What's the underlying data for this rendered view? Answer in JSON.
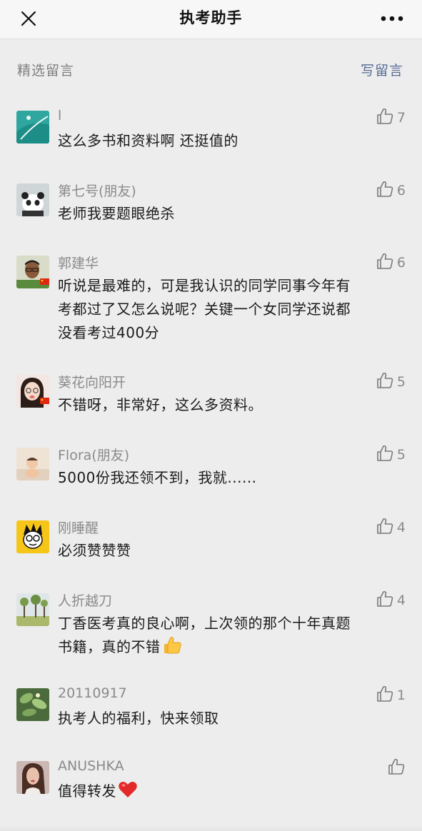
{
  "header": {
    "title": "执考助手",
    "close_icon": "close-icon",
    "more_icon": "more-icon"
  },
  "section": {
    "title": "精选留言",
    "write_label": "写留言"
  },
  "colors": {
    "link": "#576b95",
    "muted": "#8a8a8a",
    "background": "#ededed"
  },
  "comments": [
    {
      "name": "l",
      "likes": "7",
      "lines": [
        "这么多书和资料啊 还挺值的"
      ],
      "avatar_icon": "avatar-teal"
    },
    {
      "name": "第七号(朋友)",
      "likes": "6",
      "lines": [
        "老师我要题眼绝杀"
      ],
      "avatar_icon": "avatar-panda"
    },
    {
      "name": "郭建华",
      "likes": "6",
      "lines": [
        "听说是最难的，可是我认识的同学同事今年有",
        "考都过了又怎么说呢？关键一个女同学还说都",
        "没看考过400分"
      ],
      "avatar_icon": "avatar-man-flag"
    },
    {
      "name": "葵花向阳开",
      "likes": "5",
      "lines": [
        "不错呀，非常好，这么多资料。"
      ],
      "avatar_icon": "avatar-girl-flag"
    },
    {
      "name": "Flora(朋友)",
      "likes": "5",
      "lines": [
        "5000份我还领不到，我就......"
      ],
      "avatar_icon": "avatar-baby"
    },
    {
      "name": "刚睡醒",
      "likes": "4",
      "lines": [
        "必须赞赞赞"
      ],
      "avatar_icon": "avatar-cartoon"
    },
    {
      "name": "人折越刀",
      "likes": "4",
      "lines": [
        "丁香医考真的良心啊，上次领的那个十年真题",
        "书籍，真的不错"
      ],
      "avatar_icon": "avatar-trees",
      "emoji_after": "thumbs-up-emoji"
    },
    {
      "name": "20110917",
      "likes": "1",
      "lines": [
        "执考人的福利，快来领取"
      ],
      "avatar_icon": "avatar-plant"
    },
    {
      "name": "ANUSHKA",
      "likes": "",
      "lines": [
        "值得转发"
      ],
      "avatar_icon": "avatar-woman",
      "emoji_after": "heart-emoji"
    }
  ]
}
